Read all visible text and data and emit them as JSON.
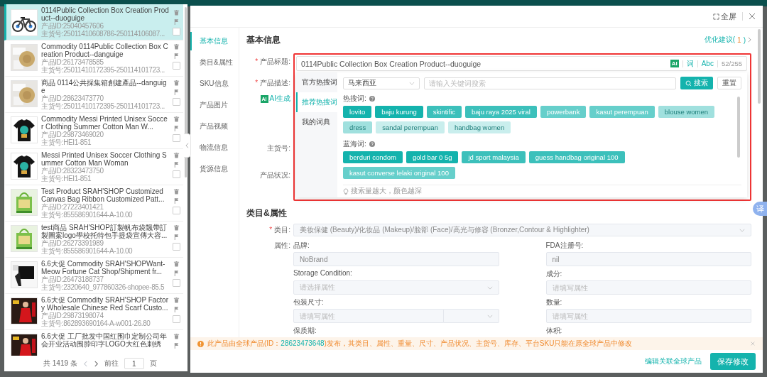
{
  "product_list": {
    "items": [
      {
        "title": "0114Public Collection Box Creation Product--duoguige",
        "product_id": "产品ID:25040457606",
        "sku": "主货号:25011410608786-250114106087...",
        "selected": true,
        "checked": false
      },
      {
        "title": "Commodity 0114Public Collection Box Creation Product--danguige",
        "product_id": "产品ID:26173478585",
        "sku": "主货号:25011410172395-250114101723...",
        "selected": false,
        "checked": false
      },
      {
        "title": "商品 0114公共採集箱創建產品--danguige",
        "product_id": "产品ID:28623473770",
        "sku": "主货号:25011410172395-250114101723...",
        "selected": false,
        "checked": false
      },
      {
        "title": "Commodity Messi Printed Unisex Soccer Clothing Summer Cotton Man W...",
        "product_id": "产品ID:29873469020",
        "sku": "主货号:HEI1-851",
        "selected": false,
        "checked": false
      },
      {
        "title": "Messi Printed Unisex Soccer Clothing Summer Cotton Man Woman",
        "product_id": "产品ID:28323473750",
        "sku": "主货号:HEI1-851",
        "selected": false,
        "checked": false
      },
      {
        "title": "Test Product SRAH'SHOP Customized Canvas Bag Ribbon Customized Patt...",
        "product_id": "产品ID:27223401421",
        "sku": "主货号:855586901644-A-10.00",
        "selected": false,
        "checked": false
      },
      {
        "title": "test商品 SRAH'SHOP訂製帆布袋飄帶訂製圖案logo學校托特包手提袋宣傳大容...",
        "product_id": "产品ID:26273391989",
        "sku": "主货号:855586901644-A-10.00",
        "selected": false,
        "checked": false
      },
      {
        "title": "6.6大促 Commodity SRAH'SHOPWant-Meow Fortune Cat Shop/Shipment fr...",
        "product_id": "产品ID:26473188737",
        "sku": "主货号:2320640_977860326-shopee-85.5",
        "selected": false,
        "checked": false
      },
      {
        "title": "6.6大促 Commodity SRAH'SHOP Factory Wholesale Chinese Red Scarf Custo...",
        "product_id": "产品ID:29873198074",
        "sku": "主货号:862893690164-A-w001-26.80",
        "selected": false,
        "checked": false
      },
      {
        "title": "6.6大促 工厂批发中国红围巾定制公司年会开业活动围脖印字LOGO大红色刺绣",
        "selected": false
      }
    ],
    "pagination": {
      "total": "共 1419 条",
      "goto": "前往",
      "page": "1",
      "page_suffix": "页"
    }
  },
  "modal": {
    "fullscreen": "全屏",
    "nav": [
      {
        "label": "基本信息",
        "selected": true
      },
      {
        "label": "类目&属性",
        "selected": false
      },
      {
        "label": "SKU信息",
        "selected": false
      },
      {
        "label": "产品图片",
        "selected": false
      },
      {
        "label": "产品视频",
        "selected": false
      },
      {
        "label": "物流信息",
        "selected": false
      },
      {
        "label": "货源信息",
        "selected": false
      }
    ],
    "basic_info": {
      "heading": "基本信息",
      "suggestion": {
        "prefix": "优化建议(",
        "count": "1",
        "suffix": ")"
      },
      "labels": [
        {
          "kind": "label",
          "marker": "*",
          "text": "产品标题:"
        },
        {
          "kind": "label",
          "marker": "*",
          "text": "产品描述:"
        },
        {
          "kind": "ai",
          "badge": "AI",
          "text": "AI生成"
        },
        {
          "kind": "label",
          "text": "主货号:"
        },
        {
          "kind": "label",
          "text": "产品状况:"
        }
      ],
      "title_field": {
        "value": "0114Public Collection Box Creation Product--duoguige",
        "ai": "AI",
        "word": "词",
        "abc": "Abc",
        "counter": "52/255"
      },
      "keyword_panel": {
        "tabs": [
          {
            "label": "官方热搜词",
            "selected": false
          },
          {
            "label": "推荐热搜词",
            "selected": true
          },
          {
            "label": "我的词典",
            "selected": false
          }
        ],
        "region": "马来西亚",
        "search_placeholder": "请输入关键词搜索",
        "search_button": "搜索",
        "reset_button": "重置",
        "groups": [
          {
            "label": "热搜词:",
            "chips": [
              {
                "text": "lovito",
                "color": "#14b3ad"
              },
              {
                "text": "baju kurung",
                "color": "#14b3ad"
              },
              {
                "text": "skintific",
                "color": "#3cc0bb"
              },
              {
                "text": "baju raya 2025 viral",
                "color": "#3cc0bb"
              },
              {
                "text": "powerbank",
                "color": "#66cfcb"
              },
              {
                "text": "kasut perempuan",
                "color": "#66cfcb"
              },
              {
                "text": "blouse women",
                "color": "#a0e0de"
              },
              {
                "text": "dress",
                "color": "#a0e0de"
              },
              {
                "text": "sandal perempuan",
                "color": "#c9eeed"
              },
              {
                "text": "handbag women",
                "color": "#c9eeed"
              }
            ]
          },
          {
            "label": "蓝海词:",
            "chips": [
              {
                "text": "berduri condom",
                "color": "#14b3ad"
              },
              {
                "text": "gold bar 0 5g",
                "color": "#14b3ad"
              },
              {
                "text": "jd sport malaysia",
                "color": "#3cc0bb"
              },
              {
                "text": "guess handbag original 100",
                "color": "#3cc0bb"
              },
              {
                "text": "kasut converse lelaki original 100",
                "color": "#66cfcb"
              }
            ]
          }
        ],
        "hint": "搜索量越大，颜色越深"
      }
    },
    "category": {
      "heading": "类目&属性",
      "label": "类目:",
      "marker": "*",
      "value": "美妆保健 (Beauty)/化妆品 (Makeup)/脸部 (Face)/高光与修容 (Bronzer,Contour & Highlighter)",
      "attributes_label": "属性:",
      "attributes": [
        {
          "label": "品牌:",
          "kind": "text",
          "value": "NoBrand"
        },
        {
          "label": "FDA注册号:",
          "kind": "text",
          "value": "nil"
        },
        {
          "label": "Storage Condition:",
          "kind": "select",
          "placeholder": "请选择属性"
        },
        {
          "label": "成分:",
          "kind": "text",
          "placeholder": "请填写属性"
        },
        {
          "label": "包装尺寸:",
          "kind": "unit",
          "placeholder": "请填写属性"
        },
        {
          "label": "数量:",
          "kind": "text",
          "placeholder": "请填写属性"
        },
        {
          "label": "保质期:",
          "kind": "none"
        },
        {
          "label": "体积:",
          "kind": "none"
        }
      ]
    },
    "warning": {
      "before": "此产品由全球产品(ID：",
      "id": "28623473648",
      "after": ")发布，其类目、属性、重量、尺寸、产品状况、主货号、库存、平台SKU只能在原全球产品中修改"
    },
    "footer": {
      "link": "编辑关联全球产品",
      "save": "保存修改"
    }
  },
  "translate_badge": "译"
}
